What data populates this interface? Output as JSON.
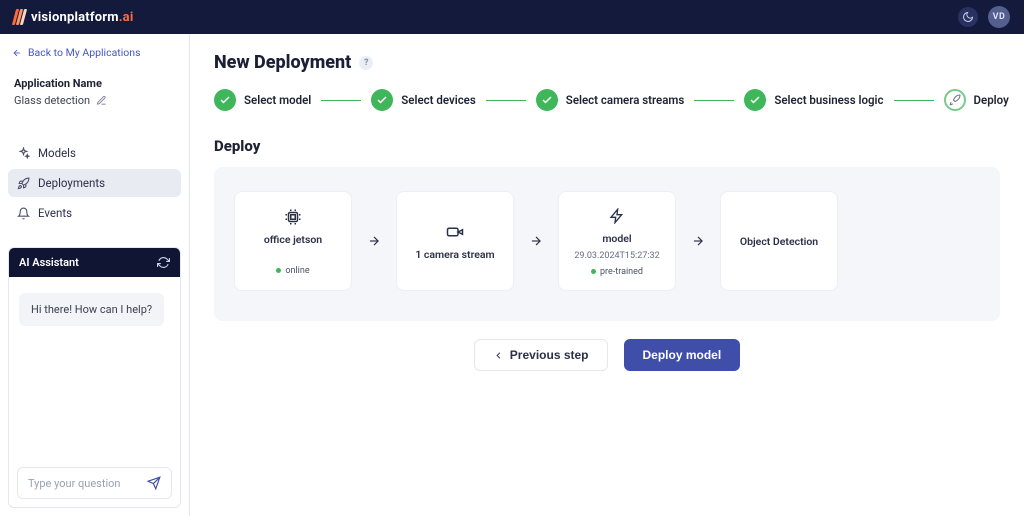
{
  "brand": {
    "name": "visionplatform",
    "suffix": ".ai"
  },
  "user": {
    "initials": "VD"
  },
  "sidebar": {
    "back_label": "Back to My Applications",
    "appname_label": "Application Name",
    "appname_value": "Glass detection",
    "nav": [
      {
        "label": "Models"
      },
      {
        "label": "Deployments"
      },
      {
        "label": "Events"
      }
    ],
    "assistant": {
      "title": "AI Assistant",
      "greeting": "Hi there! How can I help?",
      "placeholder": "Type your question"
    }
  },
  "page": {
    "title": "New Deployment",
    "section": "Deploy"
  },
  "steps": [
    {
      "label": "Select model"
    },
    {
      "label": "Select devices"
    },
    {
      "label": "Select camera streams"
    },
    {
      "label": "Select business logic"
    },
    {
      "label": "Deploy"
    }
  ],
  "cards": {
    "device": {
      "title": "office jetson",
      "status": "online"
    },
    "stream": {
      "title": "1 camera stream"
    },
    "model": {
      "title": "model",
      "subtitle": "29.03.2024T15:27:32",
      "status": "pre-trained"
    },
    "logic": {
      "title": "Object Detection"
    }
  },
  "buttons": {
    "prev": "Previous step",
    "deploy": "Deploy model"
  }
}
